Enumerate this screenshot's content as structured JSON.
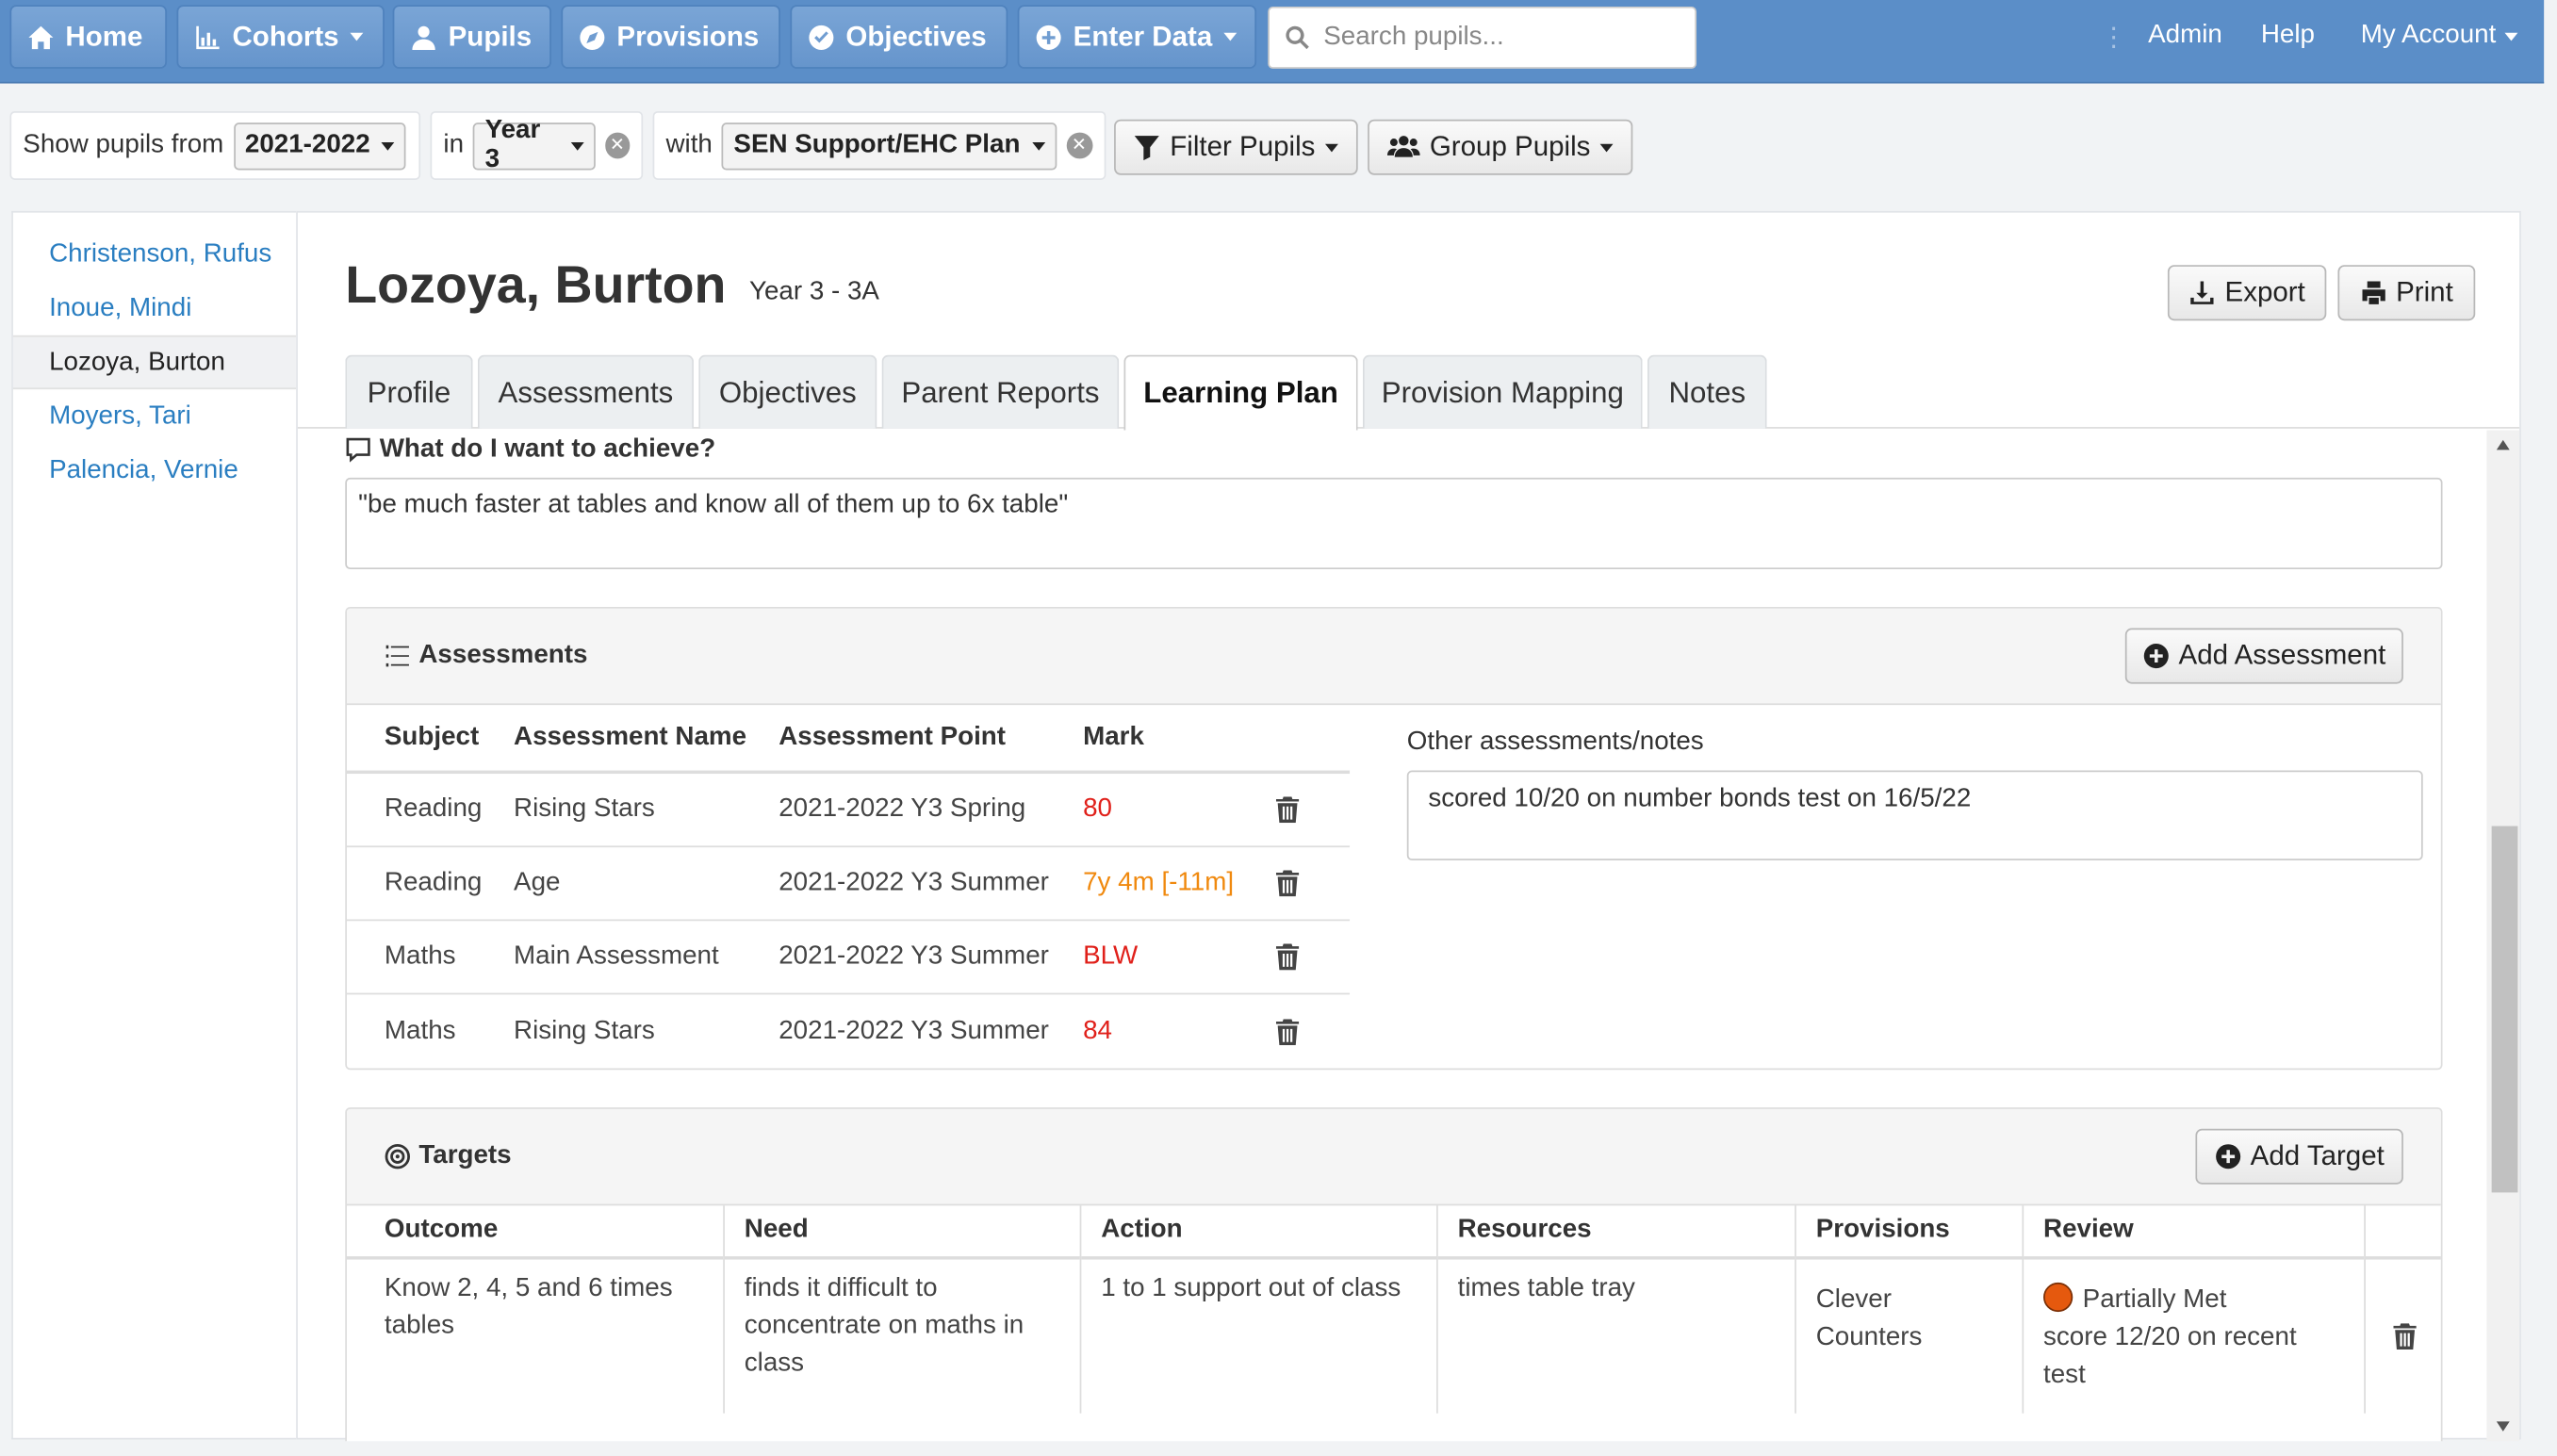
{
  "nav": {
    "home": "Home",
    "cohorts": "Cohorts",
    "pupils": "Pupils",
    "provisions": "Provisions",
    "objectives": "Objectives",
    "enter_data": "Enter Data",
    "search_placeholder": "Search pupils...",
    "admin": "Admin",
    "help": "Help",
    "my_account": "My Account",
    "dots": "⋮"
  },
  "filters": {
    "show_from_label": "Show pupils from",
    "year_value": "2021-2022",
    "in_label": "in",
    "group_value": "Year 3",
    "with_label": "with",
    "sen_value": "SEN Support/EHC Plan",
    "filter_button": "Filter Pupils",
    "group_button": "Group Pupils"
  },
  "pupils": [
    {
      "name": "Christenson, Rufus"
    },
    {
      "name": "Inoue, Mindi"
    },
    {
      "name": "Lozoya, Burton"
    },
    {
      "name": "Moyers, Tari"
    },
    {
      "name": "Palencia, Vernie"
    }
  ],
  "pupil": {
    "name": "Lozoya, Burton",
    "class": "Year 3 - 3A"
  },
  "actions": {
    "export": "Export",
    "print": "Print"
  },
  "tabs": [
    {
      "label": "Profile"
    },
    {
      "label": "Assessments"
    },
    {
      "label": "Objectives"
    },
    {
      "label": "Parent Reports"
    },
    {
      "label": "Learning Plan"
    },
    {
      "label": "Provision Mapping"
    },
    {
      "label": "Notes"
    }
  ],
  "achieve": {
    "label": "What do I want to achieve?",
    "text": "\"be much faster at tables and know all of them up to 6x table\""
  },
  "assessments": {
    "title": "Assessments",
    "add_button": "Add Assessment",
    "columns": [
      "Subject",
      "Assessment Name",
      "Assessment Point",
      "Mark"
    ],
    "rows": [
      {
        "subject": "Reading",
        "name": "Rising Stars",
        "point": "2021-2022 Y3 Spring",
        "mark": "80",
        "mark_color": "#e0201a"
      },
      {
        "subject": "Reading",
        "name": "Age",
        "point": "2021-2022 Y3 Summer",
        "mark": "7y 4m [-11m]",
        "mark_color": "#f0890e"
      },
      {
        "subject": "Maths",
        "name": "Main Assessment",
        "point": "2021-2022 Y3 Summer",
        "mark": "BLW",
        "mark_color": "#e0201a"
      },
      {
        "subject": "Maths",
        "name": "Rising Stars",
        "point": "2021-2022 Y3 Summer",
        "mark": "84",
        "mark_color": "#e0201a"
      }
    ],
    "notes_label": "Other assessments/notes",
    "notes_text": "scored 10/20 on number bonds test on 16/5/22"
  },
  "targets": {
    "title": "Targets",
    "add_button": "Add Target",
    "columns": [
      "Outcome",
      "Need",
      "Action",
      "Resources",
      "Provisions",
      "Review"
    ],
    "row": {
      "outcome": "Know 2, 4, 5 and 6 times tables",
      "need": "finds it difficult to concentrate on maths in class",
      "action": "1 to 1 support out of class",
      "resources": "times table tray",
      "provisions": "Clever Counters",
      "review_status": "Partially Met",
      "review_note": "score 12/20 on recent test",
      "status_color": "#e5590e"
    }
  }
}
